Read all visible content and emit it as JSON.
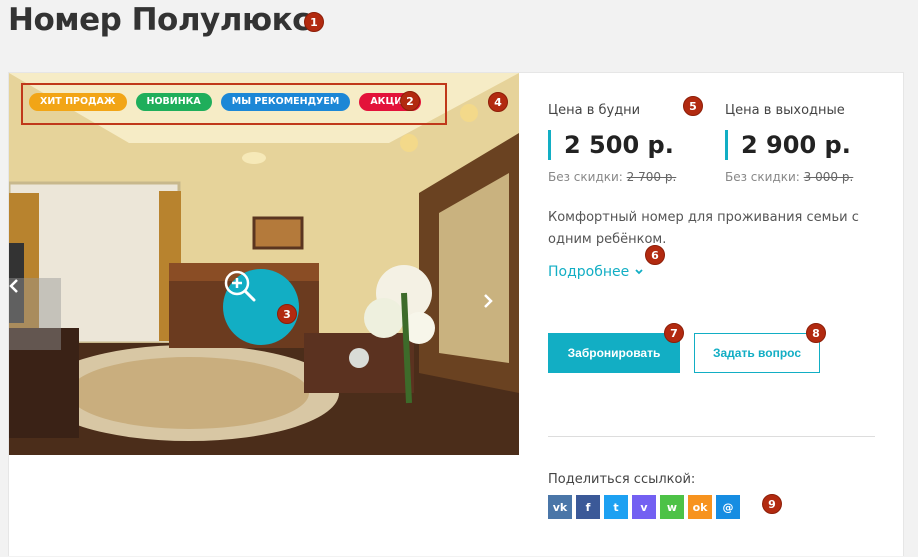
{
  "page": {
    "title": "Номер Полулюкс"
  },
  "annotations": [
    "1",
    "2",
    "3",
    "4",
    "5",
    "6",
    "7",
    "8",
    "9"
  ],
  "gallery": {
    "badges": [
      {
        "label": "ХИТ ПРОДАЖ",
        "color": "#f2a516"
      },
      {
        "label": "НОВИНКА",
        "color": "#1fae5b"
      },
      {
        "label": "МЫ РЕКОМЕНДУЕМ",
        "color": "#1c87d6"
      },
      {
        "label": "АКЦИЯ",
        "color": "#e3123a"
      }
    ],
    "zoom_icon": "zoom-plus-icon",
    "prev_icon": "chevron-left-icon",
    "next_icon": "chevron-right-icon"
  },
  "prices": {
    "weekday": {
      "label": "Цена в будни",
      "value": "2 500 р.",
      "old_label": "Без скидки:",
      "old_value": "2 700 р."
    },
    "weekend": {
      "label": "Цена в выходные",
      "value": "2 900 р.",
      "old_label": "Без скидки:",
      "old_value": "3 000 р."
    }
  },
  "description": "Комфортный номер для проживания семьи с одним ребёнком.",
  "more_link": "Подробнее",
  "buttons": {
    "book": "Забронировать",
    "ask": "Задать вопрос"
  },
  "share": {
    "label": "Поделиться ссылкой:",
    "networks": [
      {
        "name": "vk-icon",
        "glyph": "vk",
        "color": "#4a76a8"
      },
      {
        "name": "facebook-icon",
        "glyph": "f",
        "color": "#3b5998"
      },
      {
        "name": "twitter-icon",
        "glyph": "t",
        "color": "#1da1f2"
      },
      {
        "name": "viber-icon",
        "glyph": "v",
        "color": "#7360f2"
      },
      {
        "name": "whatsapp-icon",
        "glyph": "w",
        "color": "#4dc247"
      },
      {
        "name": "odnoklassniki-icon",
        "glyph": "ok",
        "color": "#f7931e"
      },
      {
        "name": "moimir-icon",
        "glyph": "@",
        "color": "#168de2"
      }
    ]
  },
  "colors": {
    "accent": "#12aec4",
    "marker": "#b22a10"
  }
}
